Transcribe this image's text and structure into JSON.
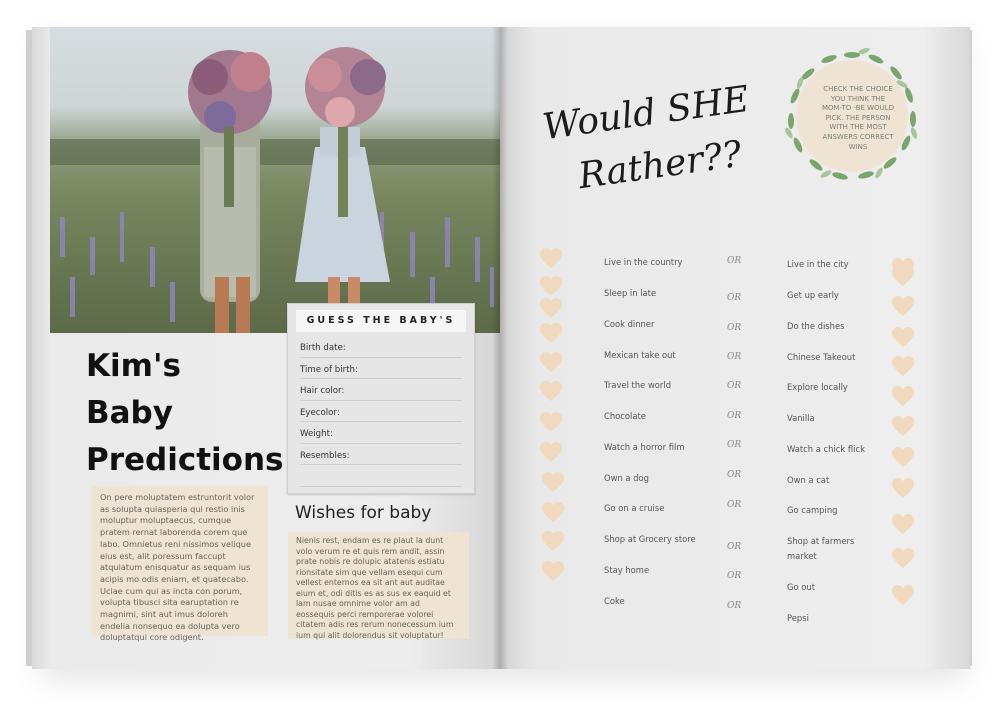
{
  "left_page": {
    "title_lines": [
      "Kim's",
      "Baby",
      "Predictions"
    ],
    "intro_text": "On pere moluptatem estruntorit volor as solupta quiasperia qui restio inis moluptur moluptaecus, cumque pratem rernat laborenda corem que labo. Omnietus reni nissimos velique eius est, alit poressum faccupt atquiatum enisquatur as sequam ius acipis mo odis eniam, et quatecabo. Uciae cum qui as incta con porum, volupta tibusci sita earuptation re magnimi, sint aut imus doloreh endelia nonsequo ea dolupta vero doluptatqui core odigent.",
    "guess_card": {
      "title": "GUESS THE BABY'S",
      "fields": [
        "Birth date:",
        "Time of birth:",
        "Hair color:",
        "Eyecolor:",
        "Weight:",
        "Resembles:"
      ]
    },
    "wishes": {
      "title": "Wishes for baby",
      "text": "Nienis rest, endam es re plaut la dunt volo verum re et quis rem andit, assin prate nobis re dolupic atatenis estiatu rionsitate sim que vellam esequi cum vellest enternos ea sit ant aut auditae eium et, odi ditis es as sus ex eaquid et lam nusae omnime volor am ad eossequis perci remporerae volorei citatem adis res rerum nonecessum ium ium qui alit dolorendus sit voluptatur!"
    }
  },
  "right_page": {
    "heading_line1": "Would SHE",
    "heading_line2": "Rather??",
    "instructions": "CHECK THE CHOICE YOU THINK THE MOM-TO -BE WOULD PICK. THE PERSON WITH THE MOST ANSWERS CORRECT WINS",
    "or_label": "OR",
    "choices": [
      {
        "left": "Live in the country",
        "right": "Live in the city"
      },
      {
        "left": "Sleep in late",
        "right": "Get up early"
      },
      {
        "left": "Cook dinner",
        "right": "Do the dishes"
      },
      {
        "left": "Mexican take out",
        "right": "Chinese Takeout"
      },
      {
        "left": "Travel the world",
        "right": "Explore locally"
      },
      {
        "left": "Chocolate",
        "right": "Vanilla"
      },
      {
        "left": "Watch a horror film",
        "right": "Watch a chick flick"
      },
      {
        "left": "Own a dog",
        "right": "Own a cat"
      },
      {
        "left": "Go on a cruise",
        "right": "Go camping"
      },
      {
        "left": "Shop at Grocery store",
        "right": "Shop at farmers market"
      },
      {
        "left": "Stay home",
        "right": "Go out"
      },
      {
        "left": "Coke",
        "right": "Pepsi"
      }
    ]
  },
  "colors": {
    "heart": "#f0d9bf",
    "card_bg": "#efe4d3",
    "leaf": "#7aa56b"
  }
}
